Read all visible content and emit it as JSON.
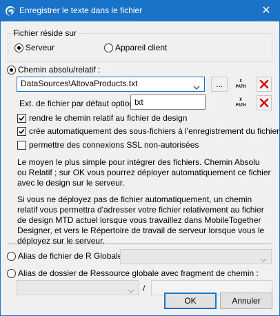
{
  "window": {
    "title": "Enregistrer le texte dans le fichier",
    "close_glyph": "✕",
    "icon": "altova-app-icon"
  },
  "location_group": {
    "legend": "Fichier réside sur",
    "options": [
      {
        "label": "Serveur",
        "checked": true
      },
      {
        "label": "Appareil client",
        "checked": false
      }
    ]
  },
  "path_section": {
    "radio_label": "Chemin absolu/relatif :",
    "radio_checked": true,
    "path_value": "DataSources\\AltovaProducts.txt",
    "browse_label": "...",
    "xpath_label_top": "X",
    "xpath_label_bottom": "PATH",
    "ext_label": "Ext. de fichier par défaut option",
    "ext_value": "txt",
    "checkboxes": [
      {
        "label": "rendre le chemin relatif au fichier de design",
        "checked": true
      },
      {
        "label": "crée automatiquement des sous-fichiers à l'enregistrement du fichier",
        "checked": true
      },
      {
        "label": "permettre des connexions SSL non-autorisées",
        "checked": false
      }
    ],
    "paragraph1": "Le moyen le plus simple pour intégrer des fichiers. Chemin Absolu ou Relatif ; sur OK vous pourrez déployer automatiquement ce fichier avec le design sur le serveur.",
    "paragraph2": "Si vous ne déployez pas de fichier automatiquement, un chemin relatif vous permettra d'adresser votre fichier relativement au fichier de design MTD actuel lorsque vous travaillez dans MobileTogether Designer, et vers le Répertoire de travail de serveur lorsque vous le déployez sur le serveur."
  },
  "global_alias": {
    "radio_label": "Alias de fichier de R Globale :",
    "checked": false
  },
  "global_folder": {
    "radio_label": "Alias de dossier de Ressource globale avec fragment de chemin :",
    "checked": false,
    "slash": "/"
  },
  "buttons": {
    "ok": "OK",
    "cancel": "Annuler"
  },
  "colors": {
    "titlebar": "#1b73c9",
    "delete_red": "#d40000"
  }
}
